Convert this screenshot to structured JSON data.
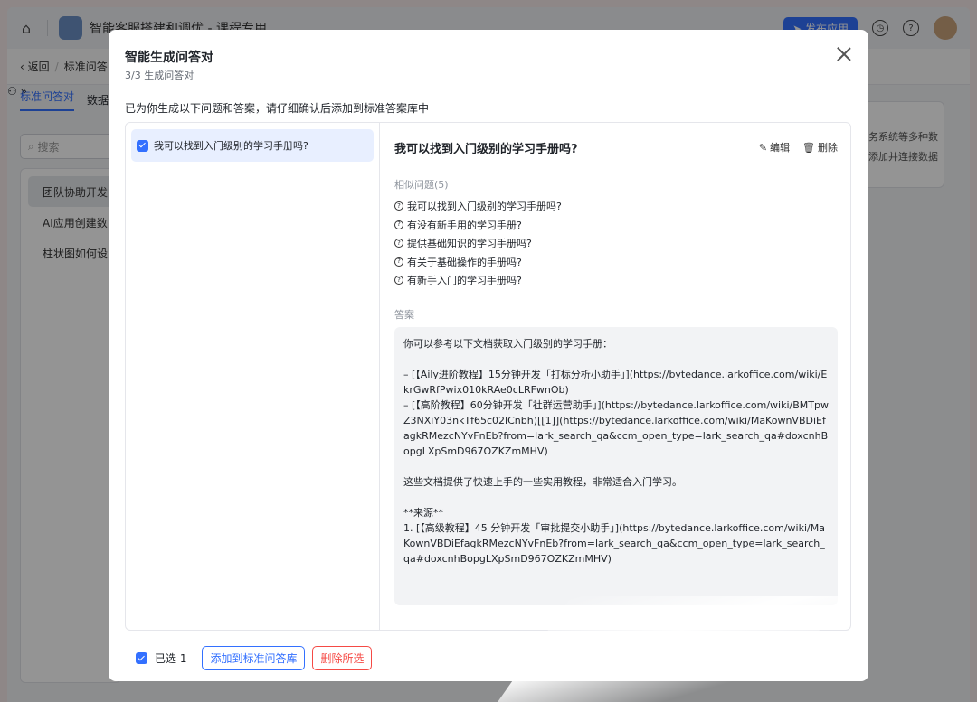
{
  "app": {
    "title": "智能客服搭建和调优 - 课程专用",
    "publish_label": "发布应用",
    "back_label": "返回",
    "breadcrumb_current": "标准问答",
    "tabs": [
      "标准问答对",
      "数据"
    ],
    "search_placeholder": "搜索",
    "list_items": [
      "团队协助开发",
      "AI应用创建数",
      "柱状图如何设"
    ],
    "right_card_lines": [
      "务系统等多种数",
      "添加并连接数据"
    ]
  },
  "dialog": {
    "title": "智能生成问答对",
    "step": "3/3 生成问答对",
    "description": "已为你生成以下问题和答案，请仔细确认后添加到标准答案库中",
    "question_list": [
      {
        "text": "我可以找到入门级别的学习手册吗?",
        "checked": true
      }
    ],
    "detail": {
      "title": "我可以找到入门级别的学习手册吗?",
      "edit_label": "编辑",
      "delete_label": "删除",
      "similar_label": "相似问题(5)",
      "similar": [
        "我可以找到入门级别的学习手册吗?",
        "有没有新手用的学习手册?",
        "提供基础知识的学习手册吗?",
        "有关于基础操作的手册吗?",
        "有新手入门的学习手册吗?"
      ],
      "answer_label": "答案",
      "answer": "你可以参考以下文档获取入门级别的学习手册：\n\n– [【Aily进阶教程】15分钟开发「打标分析小助手」](https://bytedance.larkoffice.com/wiki/EkrGwRfPwix010kRAe0cLRFwnOb)\n– [【高阶教程】60分钟开发「社群运营助手」](https://bytedance.larkoffice.com/wiki/BMTpwZ3NXiY03nkTf65c02lCnbh)[[1]](https://bytedance.larkoffice.com/wiki/MaKownVBDiEfagkRMezcNYvFnEb?from=lark_search_qa&ccm_open_type=lark_search_qa#doxcnhBopgLXpSmD967OZKZmMHV)\n\n这些文档提供了快速上手的一些实用教程，非常适合入门学习。\n\n**来源**\n1. [【高级教程】45 分钟开发「审批提交小助手」](https://bytedance.larkoffice.com/wiki/MaKownVBDiEfagkRMezcNYvFnEb?from=lark_search_qa&ccm_open_type=lark_search_qa#doxcnhBopgLXpSmD967OZKZmMHV)"
    },
    "footer": {
      "selected_label": "已选 1",
      "add_label": "添加到标准问答库",
      "delete_selected_label": "删除所选"
    }
  },
  "colors": {
    "accent": "#3370ff",
    "danger": "#f54a45"
  }
}
